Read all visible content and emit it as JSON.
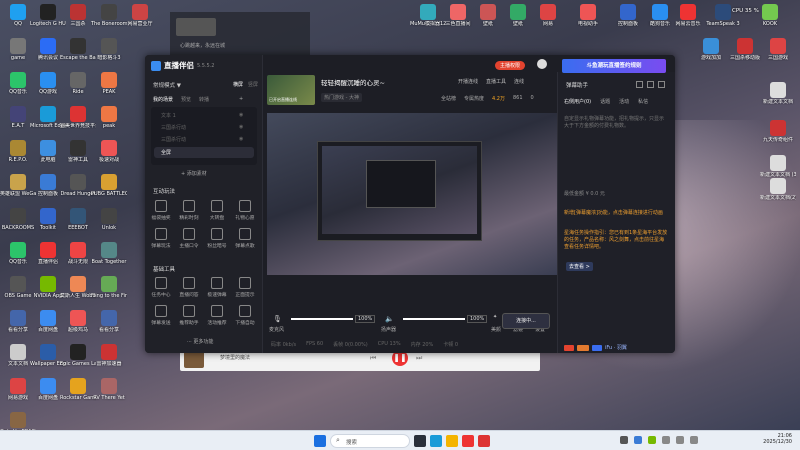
{
  "desktop": {
    "icons_left": [
      {
        "label": "QQ",
        "color": "#1fa0f0"
      },
      {
        "label": "Logitech G HUB",
        "color": "#222"
      },
      {
        "label": "三国杀",
        "color": "#b33"
      },
      {
        "label": "The Bonerooms",
        "color": "#444"
      },
      {
        "label": "网易营业厅",
        "color": "#c44"
      },
      {
        "label": "game",
        "color": "#777"
      },
      {
        "label": "腾讯会议",
        "color": "#2b6cf5"
      },
      {
        "label": "Escape the Backrooms",
        "color": "#333"
      },
      {
        "label": "暗影格斗3",
        "color": "#555"
      },
      {
        "label": "QQ音乐",
        "color": "#2cc46a"
      },
      {
        "label": "QQ游戏",
        "color": "#2a8ff0"
      },
      {
        "label": "Ride",
        "color": "#666"
      },
      {
        "label": "PEAK",
        "color": "#e74"
      },
      {
        "label": "E.A.T",
        "color": "#447"
      },
      {
        "label": "Microsoft Edge",
        "color": "#1a9bd8"
      },
      {
        "label": "完美世界竞技平台",
        "color": "#d33"
      },
      {
        "label": "peak",
        "color": "#e74"
      },
      {
        "label": "R.E.P.O.",
        "color": "#a83"
      },
      {
        "label": "此电脑",
        "color": "#3d8fe0"
      },
      {
        "label": "雷神工具",
        "color": "#333"
      },
      {
        "label": "极速对战",
        "color": "#e55"
      },
      {
        "label": "英雄联盟 WeGame",
        "color": "#c9a34b"
      },
      {
        "label": "控制面板",
        "color": "#3a7bd5"
      },
      {
        "label": "Dread Hunger",
        "color": "#555"
      },
      {
        "label": "PUBG BATTLEGROUNDS",
        "color": "#d9a031"
      },
      {
        "label": "BACKROOMS",
        "color": "#444"
      },
      {
        "label": "Toolkit",
        "color": "#36c"
      },
      {
        "label": "EEEBOT",
        "color": "#357"
      },
      {
        "label": "Unlok",
        "color": "#444"
      },
      {
        "label": "QQ音乐",
        "color": "#2cc46a"
      },
      {
        "label": "直播伴侣",
        "color": "#e33"
      },
      {
        "label": "战斗无限",
        "color": "#e44"
      },
      {
        "label": "Boat Together",
        "color": "#588"
      },
      {
        "label": "OBS Game",
        "color": "#555"
      },
      {
        "label": "NVIDIA App",
        "color": "#76b900"
      },
      {
        "label": "莫斯人生 Wobbly Life",
        "color": "#e85"
      },
      {
        "label": "Fling to the Finish",
        "color": "#6a5"
      },
      {
        "label": "看看分享",
        "color": "#46a"
      },
      {
        "label": "百度网盘",
        "color": "#3c8cf0"
      },
      {
        "label": "超级鸡马",
        "color": "#e55"
      },
      {
        "label": "看看分享",
        "color": "#46a"
      },
      {
        "label": "文本文档",
        "color": "#ccc"
      },
      {
        "label": "Wallpaper Engine",
        "color": "#2b5da8"
      },
      {
        "label": "Epic Games Launcher",
        "color": "#222"
      },
      {
        "label": "雷神加速器",
        "color": "#c33"
      },
      {
        "label": "网易游戏",
        "color": "#d44"
      },
      {
        "label": "百度网盘",
        "color": "#3c8cf0"
      },
      {
        "label": "Rockstar Games",
        "color": "#e5a31e"
      },
      {
        "label": "RV There Yet",
        "color": "#a66"
      },
      {
        "label": "Only Up BRAINR...",
        "color": "#864"
      }
    ],
    "icons_top_right": [
      {
        "label": "MuMu模拟器12",
        "color": "#3ab"
      },
      {
        "label": "三色直播间",
        "color": "#e66"
      },
      {
        "label": "壁纸",
        "color": "#c55"
      },
      {
        "label": "壁纸",
        "color": "#3a6"
      },
      {
        "label": "网易",
        "color": "#d44"
      },
      {
        "label": "电视助手",
        "color": "#e55"
      },
      {
        "label": "控制面板",
        "color": "#36c"
      },
      {
        "label": "酷狗音乐",
        "color": "#2a8ff0"
      },
      {
        "label": "网易云音乐",
        "color": "#e33"
      },
      {
        "label": "TeamSpeak 3",
        "color": "#2c4b7a"
      },
      {
        "label": "KOOK",
        "color": "#74c94f"
      }
    ],
    "icons_right": [
      {
        "label": "游戏加加",
        "color": "#3a8fd8"
      },
      {
        "label": "三国杀移动版",
        "color": "#c33"
      },
      {
        "label": "三国游戏",
        "color": "#d44"
      },
      {
        "label": "新建文本文档",
        "color": "#ddd"
      },
      {
        "label": "九天传奇组件",
        "color": "#c33"
      },
      {
        "label": "新建文本文档 (3)",
        "color": "#ddd"
      },
      {
        "label": "新建文本文档(2)",
        "color": "#ddd"
      }
    ],
    "ghost_text": [
      "心跳越来，永远在城",
      "梦境里的魔法"
    ]
  },
  "app": {
    "name": "直播伴侣",
    "version": "5.5.5.2",
    "left": {
      "mode": "常规模式 ▼",
      "switch_labels": [
        "横屏",
        "竖屏"
      ],
      "scene_tabs": [
        "我的场景",
        "预览",
        "转播"
      ],
      "scene_rows": [
        {
          "label": "文本 1"
        },
        {
          "label": "三国杀行动"
        },
        {
          "label": "三国杀行动"
        },
        {
          "label": "全屏"
        }
      ],
      "add_source": "+ 添加素材",
      "interactive_title": "互动玩法",
      "interactive": [
        [
          "福袋抽奖",
          "精彩时刻",
          "大转盘",
          "礼物心愿"
        ],
        [
          "弹幕玩法",
          "主播口令",
          "粉丝暗号",
          "弹幕点歌"
        ]
      ],
      "basic_title": "基础工具",
      "basic": [
        [
          "任务中心",
          "直播问答",
          "极速弹幕",
          "正面提示"
        ],
        [
          "弹幕发送",
          "推荐助手",
          "活动推荐",
          "下播自动"
        ]
      ],
      "more": "··· 更多功能"
    },
    "top": {
      "title": "轻轻揭醒沉睡的心灵~",
      "tag": "热门游戏 - 大神",
      "thumb_text": "已开启直播连线",
      "status": "主播权限",
      "actions": [
        "开播连线",
        "直播工具",
        "连线"
      ],
      "stats": [
        {
          "label": "全站榜",
          "value": ""
        },
        {
          "label": "专属热度",
          "value": "4.2万"
        },
        {
          "label": "人气",
          "value": "861"
        },
        {
          "label": "",
          "value": "0"
        }
      ]
    },
    "bottom": {
      "mic_label": "麦克风",
      "mic_level": "100%",
      "spk_label": "扬声器",
      "spk_level": "100%",
      "tools": [
        "美颜",
        "滤镜",
        "设置"
      ],
      "live_button": "连接中...",
      "status_items": [
        "码率 0kb/s",
        "FPS 60",
        "丢帧 0(0.00%)",
        "CPU 13%",
        "内存 20%",
        "卡顿 0"
      ]
    },
    "chat": {
      "title": "弹幕助手",
      "tabs": [
        "右侧用户(0)",
        "话题",
        "活动",
        "私信"
      ],
      "warning": "自定显示礼物弹幕功能，招礼物提示，只显示大于下方金额的付费礼物数。",
      "rule": "最低金额 ¥ 0.0 元",
      "msg1": "新增[弹幕魔浓]功能，点击弹幕连接进行动画",
      "msg2": "星海任务操作指引：您已有到1条星海平台发放的任务，产品名称：风之剑舞，点击前往星海查看任务详情吧。",
      "msg_link": "去查看 >",
      "users": "iFu · 羽翼",
      "bottom_label": "来源",
      "banner": "斗鱼潮玩直播签约规则"
    }
  },
  "taskbar": {
    "search_placeholder": "搜索",
    "time": "21:06",
    "date": "2025/12/30",
    "tray": [
      "CPU",
      "GPU",
      "FPS"
    ],
    "cpu_text": "CPU 35 %"
  }
}
